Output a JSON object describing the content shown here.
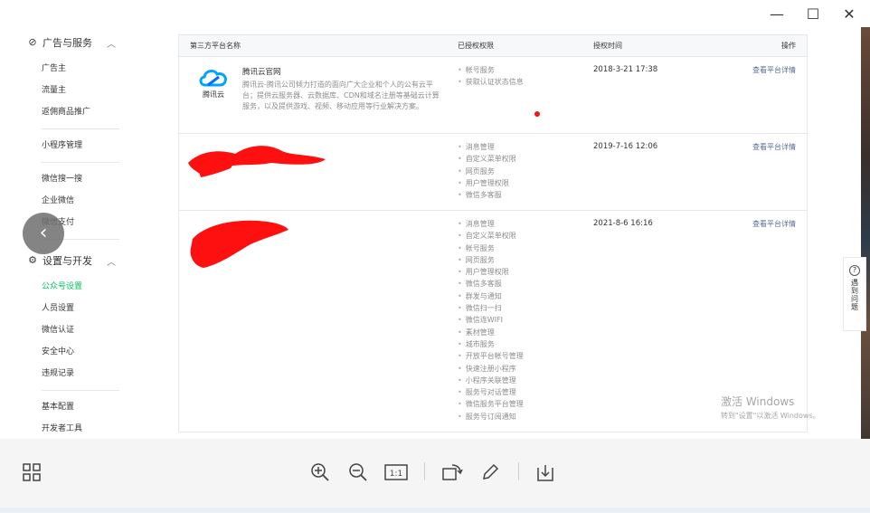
{
  "window": {
    "minimize": "—",
    "maximize": "☐",
    "close": "✕"
  },
  "sidebar": {
    "group1": {
      "label": "广告与服务"
    },
    "items1": [
      "广告主",
      "流量主",
      "返佣商品推广"
    ],
    "items2": [
      "小程序管理"
    ],
    "items3": [
      "微信搜一搜",
      "企业微信",
      "微信支付"
    ],
    "group2": {
      "label": "设置与开发"
    },
    "items4": [
      "公众号设置",
      "人员设置",
      "微信认证",
      "安全中心",
      "违规记录"
    ],
    "items5": [
      "基本配置",
      "开发者工具"
    ]
  },
  "table": {
    "headers": {
      "name": "第三方平台名称",
      "perms": "已授权权限",
      "time": "授权时间",
      "action": "操作"
    },
    "rows": [
      {
        "logo_text": "腾讯云",
        "name": "腾讯云官网",
        "desc": "腾讯云-腾讯公司倾力打造的面向广大企业和个人的公有云平台；提供云服务器、云数据库、CDN和域名注册等基础云计算服务，以及提供游戏、视频、移动应用等行业解决方案。",
        "perms": [
          "帐号服务",
          "获取认证状态信息"
        ],
        "time": "2018-3-21 17:38",
        "action": "查看平台详情"
      },
      {
        "perms": [
          "消息管理",
          "自定义菜单权限",
          "网页服务",
          "用户管理权限",
          "微信多客服"
        ],
        "time": "2019-7-16 12:06",
        "action": "查看平台详情"
      },
      {
        "perms": [
          "消息管理",
          "自定义菜单权限",
          "帐号服务",
          "网页服务",
          "用户管理权限",
          "微信多客服",
          "群发与通知",
          "微信扫一扫",
          "微信连WIFI",
          "素材管理",
          "城市服务",
          "开放平台帐号管理",
          "快速注册小程序",
          "小程序关联管理",
          "服务号对话管理",
          "微信服务平台管理",
          "服务号订阅通知"
        ],
        "time": "2021-8-6 16:16",
        "action": "查看平台详情"
      }
    ]
  },
  "help": {
    "text": "遇到问题"
  },
  "watermark": {
    "line1": "激活 Windows",
    "line2": "转到\"设置\"以激活 Windows。"
  },
  "colors": {
    "accent": "#07c160",
    "link": "#576b95",
    "redaction": "#ff0000"
  }
}
